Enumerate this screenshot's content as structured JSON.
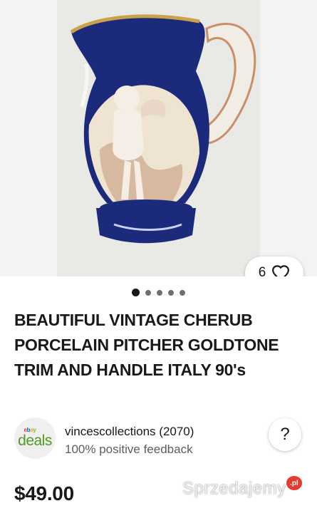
{
  "listing": {
    "watch_count": "6",
    "title": "BEAUTIFUL VINTAGE CHERUB PORCELAIN PITCHER GOLDTONE TRIM AND HANDLE ITALY 90's",
    "price": "$49.00"
  },
  "gallery": {
    "dots_total": 5,
    "active_dot": 1
  },
  "seller": {
    "logo_small": "ebay",
    "logo_word": "deals",
    "name": "vincescollections (2070)",
    "feedback": "100% positive feedback",
    "help_label": "?"
  },
  "watermark": {
    "text": "Sprzedajemy",
    "badge": ".pl"
  },
  "icons": [
    "heart-icon",
    "help-icon"
  ],
  "colors": {
    "deals_green": "#4f9a1c",
    "text": "#191919",
    "cobalt": "#1b2a7a"
  }
}
